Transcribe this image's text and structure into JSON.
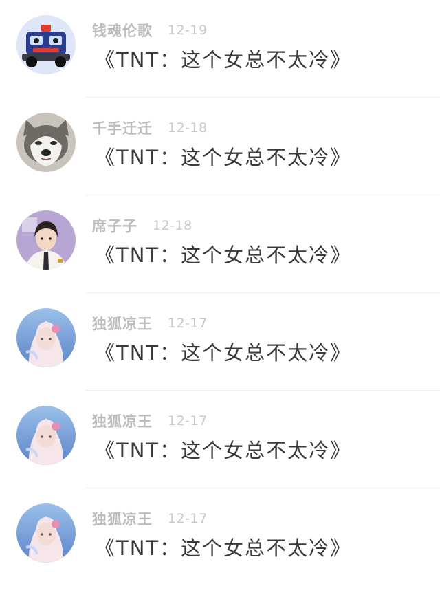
{
  "feed": {
    "items": [
      {
        "username": "钱魂伦歌",
        "date": "12-19",
        "text": "《TNT：这个女总不太冷》",
        "avatar_icon": "robot-car-avatar",
        "colors": {
          "bg": "#dfe6f7",
          "main": "#2b3d8f",
          "accent": "#e23b2e"
        }
      },
      {
        "username": "千手迁迁",
        "date": "12-18",
        "text": "《TNT：这个女总不太冷》",
        "avatar_icon": "husky-dog-avatar",
        "colors": {
          "bg": "#c9c4bb",
          "main": "#6f6a63",
          "accent": "#f4f2ee"
        }
      },
      {
        "username": "席子子",
        "date": "12-18",
        "text": "《TNT：这个女总不太冷》",
        "avatar_icon": "student-boy-avatar",
        "colors": {
          "bg": "#b7a6d3",
          "main": "#2b221c",
          "accent": "#f6f3ef"
        }
      },
      {
        "username": "独狐凉王",
        "date": "12-17",
        "text": "《TNT：这个女总不太冷》",
        "avatar_icon": "girl-portrait-avatar",
        "colors": {
          "bg": "#7aa0d6",
          "main": "#f0d9d3",
          "accent": "#e98fb5"
        }
      },
      {
        "username": "独狐凉王",
        "date": "12-17",
        "text": "《TNT：这个女总不太冷》",
        "avatar_icon": "girl-portrait-avatar",
        "colors": {
          "bg": "#7aa0d6",
          "main": "#f0d9d3",
          "accent": "#e98fb5"
        }
      },
      {
        "username": "独狐凉王",
        "date": "12-17",
        "text": "《TNT：这个女总不太冷》",
        "avatar_icon": "girl-portrait-avatar",
        "colors": {
          "bg": "#7aa0d6",
          "main": "#f0d9d3",
          "accent": "#e98fb5"
        }
      }
    ]
  }
}
